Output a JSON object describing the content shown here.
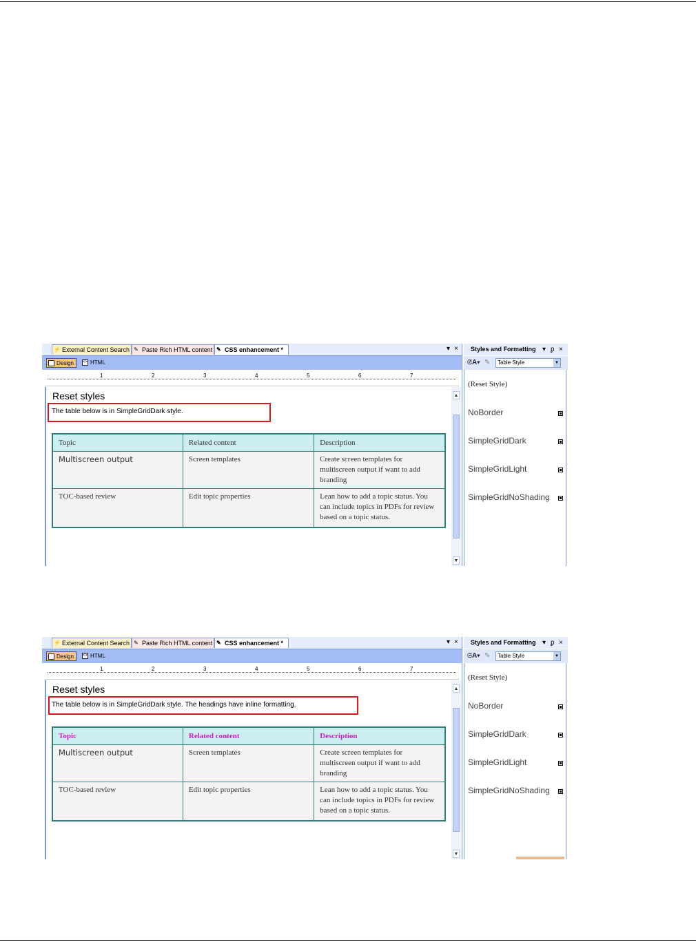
{
  "tabs": [
    {
      "label": "External Content Search"
    },
    {
      "label": "Paste Rich HTML content *"
    },
    {
      "label": "CSS enhancement *"
    }
  ],
  "tab_controls": {
    "menu": "▾",
    "close": "×"
  },
  "view_buttons": {
    "design": "Design",
    "html": "HTML"
  },
  "ruler_numbers": [
    "1",
    "2",
    "3",
    "4",
    "5",
    "6",
    "7"
  ],
  "panel": {
    "title": "Styles and Formatting",
    "pin": "ᵱ",
    "close": "×",
    "dropdown_value": "Table Style",
    "styles": [
      "(Reset Style)",
      "NoBorder",
      "SimpleGridDark",
      "SimpleGridLight",
      "SimpleGridNoShading"
    ]
  },
  "screenshot1": {
    "heading": "Reset styles",
    "paragraph": "The table below is in SimpleGridDark style.",
    "table": {
      "headers": [
        "Topic",
        "Related content",
        "Description"
      ],
      "rows": [
        [
          "Multiscreen output",
          "Screen templates",
          "Create screen templates for multiscreen output if want to add branding"
        ],
        [
          "TOC-based review",
          "Edit topic properties",
          "Lean how to add a topic status. You can include topics in PDFs for review based on a topic status."
        ]
      ]
    }
  },
  "screenshot2": {
    "heading": "Reset styles",
    "paragraph": "The table below is in SimpleGridDark style. The headings have inline formatting.",
    "table": {
      "headers": [
        "Topic",
        "Related content",
        "Description"
      ],
      "header_color": "#d01ccc",
      "rows": [
        [
          "Multiscreen output",
          "Screen templates",
          "Create screen templates for multiscreen output if want to add branding"
        ],
        [
          "TOC-based review",
          "Edit topic properties",
          "Lean how to add a topic status. You can include topics in PDFs for review based on a topic status."
        ]
      ]
    }
  },
  "colors": {
    "accent_red": "#e0141b",
    "table_border": "#2b7f76",
    "header_fill": "#cdeef0"
  }
}
